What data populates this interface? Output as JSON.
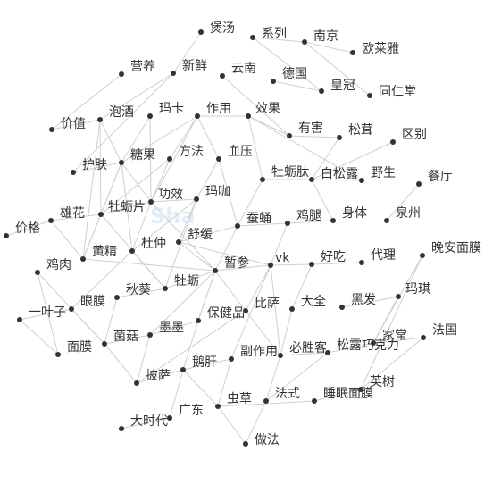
{
  "chart_data": {
    "type": "network",
    "nodes": [
      {
        "id": "n1",
        "label": "煲汤"
      },
      {
        "id": "n2",
        "label": "系列"
      },
      {
        "id": "n3",
        "label": "南京"
      },
      {
        "id": "n4",
        "label": "欧莱雅"
      },
      {
        "id": "n5",
        "label": "营养"
      },
      {
        "id": "n6",
        "label": "新鲜"
      },
      {
        "id": "n7",
        "label": "云南"
      },
      {
        "id": "n8",
        "label": "德国"
      },
      {
        "id": "n9",
        "label": "皇冠"
      },
      {
        "id": "n10",
        "label": "同仁堂"
      },
      {
        "id": "n11",
        "label": "价值"
      },
      {
        "id": "n12",
        "label": "泡酒"
      },
      {
        "id": "n13",
        "label": "玛卡"
      },
      {
        "id": "n14",
        "label": "作用"
      },
      {
        "id": "n15",
        "label": "效果"
      },
      {
        "id": "n16",
        "label": "有害"
      },
      {
        "id": "n17",
        "label": "松茸"
      },
      {
        "id": "n18",
        "label": "区别"
      },
      {
        "id": "n19",
        "label": "护肤"
      },
      {
        "id": "n20",
        "label": "糖果"
      },
      {
        "id": "n21",
        "label": "方法"
      },
      {
        "id": "n22",
        "label": "血压"
      },
      {
        "id": "n23",
        "label": "牡蛎肽"
      },
      {
        "id": "n24",
        "label": "白松露"
      },
      {
        "id": "n25",
        "label": "野生"
      },
      {
        "id": "n26",
        "label": "餐厅"
      },
      {
        "id": "n27",
        "label": "功效"
      },
      {
        "id": "n28",
        "label": "玛咖"
      },
      {
        "id": "n29",
        "label": "牡蛎片"
      },
      {
        "id": "n30",
        "label": "雄花"
      },
      {
        "id": "n31",
        "label": "蚕蛹"
      },
      {
        "id": "n32",
        "label": "鸡腿"
      },
      {
        "id": "n33",
        "label": "身体"
      },
      {
        "id": "n34",
        "label": "泉州"
      },
      {
        "id": "n35",
        "label": "价格"
      },
      {
        "id": "n36",
        "label": "杜仲"
      },
      {
        "id": "n37",
        "label": "舒缓"
      },
      {
        "id": "n38",
        "label": "黄精"
      },
      {
        "id": "n39",
        "label": "鸡肉"
      },
      {
        "id": "n40",
        "label": "牡蛎"
      },
      {
        "id": "n41",
        "label": "暂参"
      },
      {
        "id": "n42",
        "label": "vk"
      },
      {
        "id": "n43",
        "label": "好吃"
      },
      {
        "id": "n44",
        "label": "代理"
      },
      {
        "id": "n45",
        "label": "晚安面膜"
      },
      {
        "id": "n46",
        "label": "秋葵"
      },
      {
        "id": "n47",
        "label": "眼膜"
      },
      {
        "id": "n48",
        "label": "玛琪"
      },
      {
        "id": "n49",
        "label": "一叶子"
      },
      {
        "id": "n50",
        "label": "比萨"
      },
      {
        "id": "n51",
        "label": "大全"
      },
      {
        "id": "n52",
        "label": "黑发"
      },
      {
        "id": "n53",
        "label": "保健品"
      },
      {
        "id": "n54",
        "label": "墨墨"
      },
      {
        "id": "n55",
        "label": "菌菇"
      },
      {
        "id": "n56",
        "label": "面膜"
      },
      {
        "id": "n57",
        "label": "法国"
      },
      {
        "id": "n58",
        "label": "家常"
      },
      {
        "id": "n59",
        "label": "松露巧克力"
      },
      {
        "id": "n60",
        "label": "副作用"
      },
      {
        "id": "n61",
        "label": "必胜客"
      },
      {
        "id": "n62",
        "label": "鹅肝"
      },
      {
        "id": "n63",
        "label": "披萨"
      },
      {
        "id": "n64",
        "label": "英树"
      },
      {
        "id": "n65",
        "label": "法式"
      },
      {
        "id": "n66",
        "label": "睡眠面膜"
      },
      {
        "id": "n67",
        "label": "虫草"
      },
      {
        "id": "n68",
        "label": "广东"
      },
      {
        "id": "n69",
        "label": "大时代"
      },
      {
        "id": "n70",
        "label": "做法"
      }
    ],
    "edges": [
      [
        "n1",
        "n6"
      ],
      [
        "n2",
        "n3"
      ],
      [
        "n3",
        "n4"
      ],
      [
        "n3",
        "n10"
      ],
      [
        "n2",
        "n9"
      ],
      [
        "n5",
        "n11"
      ],
      [
        "n6",
        "n12"
      ],
      [
        "n6",
        "n19"
      ],
      [
        "n7",
        "n16"
      ],
      [
        "n8",
        "n9"
      ],
      [
        "n11",
        "n12"
      ],
      [
        "n12",
        "n29"
      ],
      [
        "n12",
        "n20"
      ],
      [
        "n12",
        "n38"
      ],
      [
        "n13",
        "n27"
      ],
      [
        "n13",
        "n20"
      ],
      [
        "n14",
        "n15"
      ],
      [
        "n14",
        "n20"
      ],
      [
        "n14",
        "n27"
      ],
      [
        "n14",
        "n21"
      ],
      [
        "n14",
        "n22"
      ],
      [
        "n15",
        "n16"
      ],
      [
        "n15",
        "n23"
      ],
      [
        "n16",
        "n17"
      ],
      [
        "n17",
        "n24"
      ],
      [
        "n18",
        "n24"
      ],
      [
        "n19",
        "n20"
      ],
      [
        "n20",
        "n27"
      ],
      [
        "n20",
        "n29"
      ],
      [
        "n20",
        "n36"
      ],
      [
        "n20",
        "n38"
      ],
      [
        "n21",
        "n27"
      ],
      [
        "n21",
        "n29"
      ],
      [
        "n22",
        "n31"
      ],
      [
        "n22",
        "n28"
      ],
      [
        "n23",
        "n24"
      ],
      [
        "n23",
        "n31"
      ],
      [
        "n24",
        "n25"
      ],
      [
        "n24",
        "n33"
      ],
      [
        "n26",
        "n34"
      ],
      [
        "n27",
        "n28"
      ],
      [
        "n27",
        "n29"
      ],
      [
        "n27",
        "n36"
      ],
      [
        "n27",
        "n41"
      ],
      [
        "n28",
        "n37"
      ],
      [
        "n28",
        "n40"
      ],
      [
        "n28",
        "n36"
      ],
      [
        "n29",
        "n30"
      ],
      [
        "n29",
        "n38"
      ],
      [
        "n29",
        "n40"
      ],
      [
        "n30",
        "n35"
      ],
      [
        "n30",
        "n38"
      ],
      [
        "n31",
        "n32"
      ],
      [
        "n31",
        "n41"
      ],
      [
        "n31",
        "n37"
      ],
      [
        "n32",
        "n33"
      ],
      [
        "n32",
        "n42"
      ],
      [
        "n36",
        "n40"
      ],
      [
        "n36",
        "n47"
      ],
      [
        "n37",
        "n41"
      ],
      [
        "n38",
        "n41"
      ],
      [
        "n39",
        "n56"
      ],
      [
        "n39",
        "n55"
      ],
      [
        "n40",
        "n41"
      ],
      [
        "n40",
        "n46"
      ],
      [
        "n41",
        "n42"
      ],
      [
        "n41",
        "n50"
      ],
      [
        "n41",
        "n53"
      ],
      [
        "n41",
        "n54"
      ],
      [
        "n42",
        "n43"
      ],
      [
        "n42",
        "n50"
      ],
      [
        "n42",
        "n60"
      ],
      [
        "n42",
        "n61"
      ],
      [
        "n43",
        "n44"
      ],
      [
        "n43",
        "n51"
      ],
      [
        "n45",
        "n58"
      ],
      [
        "n45",
        "n64"
      ],
      [
        "n46",
        "n55"
      ],
      [
        "n47",
        "n55"
      ],
      [
        "n48",
        "n52"
      ],
      [
        "n48",
        "n58"
      ],
      [
        "n49",
        "n56"
      ],
      [
        "n49",
        "n47"
      ],
      [
        "n50",
        "n61"
      ],
      [
        "n50",
        "n63"
      ],
      [
        "n51",
        "n61"
      ],
      [
        "n53",
        "n54"
      ],
      [
        "n53",
        "n62"
      ],
      [
        "n54",
        "n55"
      ],
      [
        "n54",
        "n63"
      ],
      [
        "n55",
        "n63"
      ],
      [
        "n57",
        "n58"
      ],
      [
        "n57",
        "n64"
      ],
      [
        "n58",
        "n59"
      ],
      [
        "n59",
        "n65"
      ],
      [
        "n59",
        "n61"
      ],
      [
        "n60",
        "n62"
      ],
      [
        "n60",
        "n67"
      ],
      [
        "n61",
        "n65"
      ],
      [
        "n62",
        "n63"
      ],
      [
        "n62",
        "n67"
      ],
      [
        "n62",
        "n68"
      ],
      [
        "n64",
        "n66"
      ],
      [
        "n65",
        "n70"
      ],
      [
        "n66",
        "n67"
      ],
      [
        "n67",
        "n70"
      ],
      [
        "n68",
        "n69"
      ],
      [
        "n53",
        "n41"
      ],
      [
        "n37",
        "n42"
      ],
      [
        "n15",
        "n25"
      ]
    ]
  },
  "watermark": "Sha"
}
